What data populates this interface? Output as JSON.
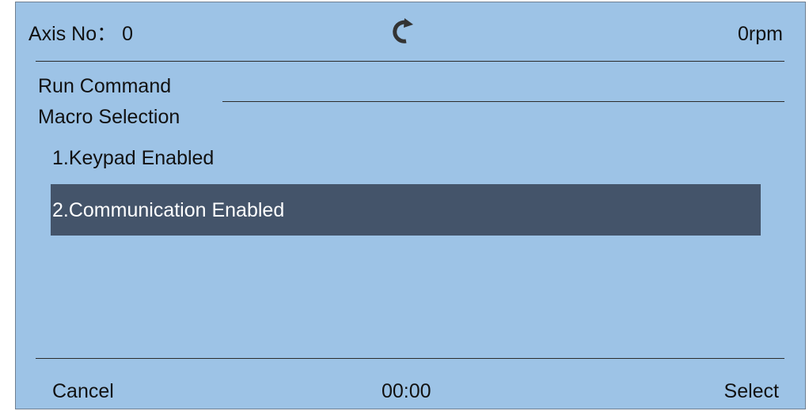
{
  "header": {
    "axis_label": "Axis No： 0",
    "rotation_icon": "clockwise-rotation-icon",
    "speed": "0rpm"
  },
  "menu": {
    "title": "Run Command",
    "subtitle": "Macro Selection",
    "options": [
      {
        "label": "1.Keypad Enabled",
        "selected": false
      },
      {
        "label": "2.Communication Enabled",
        "selected": true
      }
    ]
  },
  "footer": {
    "cancel_label": "Cancel",
    "timer": "00:00",
    "select_label": "Select"
  },
  "colors": {
    "screen_background": "#9dc3e6",
    "selection_background": "#44546a",
    "selection_text": "#ffffff",
    "text": "#111111"
  }
}
